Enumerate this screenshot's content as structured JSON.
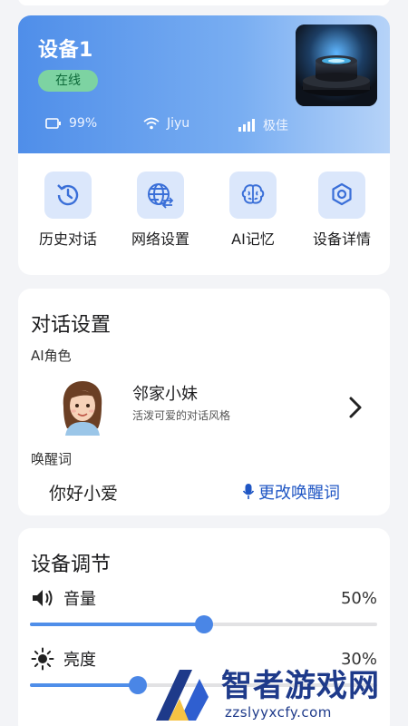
{
  "device": {
    "name": "设备1",
    "status": "在线",
    "battery": "99%",
    "wifi": "Jiyu",
    "signal": "极佳",
    "image_icon": "smart-speaker-image"
  },
  "actions": [
    {
      "label": "历史对话",
      "icon": "history-icon"
    },
    {
      "label": "网络设置",
      "icon": "network-globe-icon"
    },
    {
      "label": "AI记忆",
      "icon": "brain-icon"
    },
    {
      "label": "设备详情",
      "icon": "gear-icon"
    }
  ],
  "dialog": {
    "title": "对话设置",
    "role_label": "AI角色",
    "role_name": "邻家小妹",
    "role_desc": "活泼可爱的对话风格",
    "wake_label": "唤醒词",
    "wake_word": "你好小爱",
    "change_wake": "更改唤醒词"
  },
  "adjust": {
    "title": "设备调节",
    "volume": {
      "label": "音量",
      "value_text": "50%",
      "value": 0.5
    },
    "brightness": {
      "label": "亮度",
      "value_text": "30%",
      "value": 0.31
    }
  },
  "watermark": {
    "text": "智者游戏网",
    "url": "zzslyyxcfy.com"
  },
  "colors": {
    "accent": "#4f8ee9",
    "link": "#1f56c4",
    "online_bg": "#7dd3a2",
    "icon_bg": "#dbe7fb"
  }
}
